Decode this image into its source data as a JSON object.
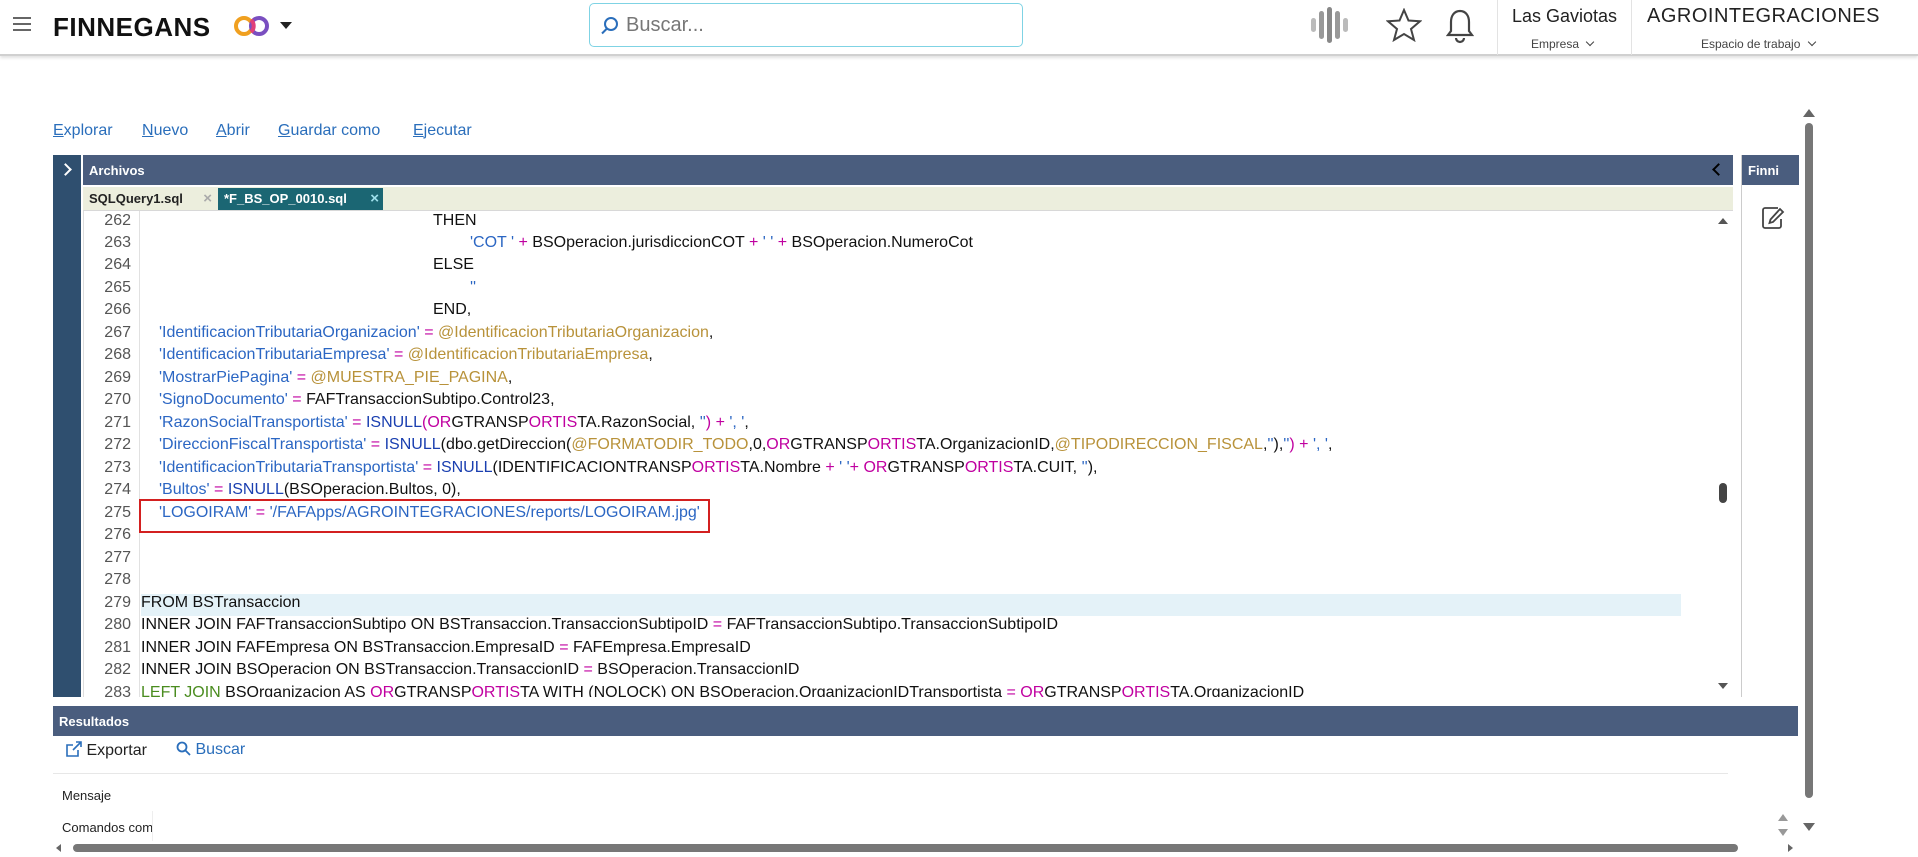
{
  "header": {
    "brand": "FINNEGANS",
    "search_placeholder": "Buscar...",
    "company_name": "Las Gaviotas",
    "company_label": "Empresa",
    "workspace_name": "AGROINTEGRACIONES",
    "workspace_label": "Espacio de trabajo",
    "icons": [
      "menu-icon",
      "brand-logo-icon",
      "chevron-down-icon",
      "search-icon",
      "voice-icon",
      "star-icon",
      "bell-icon"
    ]
  },
  "toolbar": {
    "explorar": {
      "first": "E",
      "rest": "xplorar"
    },
    "nuevo": {
      "first": "N",
      "rest": "uevo"
    },
    "abrir": {
      "first": "A",
      "rest": "brir"
    },
    "guardar": {
      "first": "G",
      "rest": "uardar como"
    },
    "ejecutar": {
      "first": "E",
      "rest": "jecutar"
    }
  },
  "editor": {
    "panel_title": "Archivos",
    "side_panel_title": "Finni",
    "tabs": [
      {
        "label": "SQLQuery1.sql",
        "active": false
      },
      {
        "label": "*F_BS_OP_0010.sql",
        "active": true
      }
    ],
    "line_numbers": [
      "262",
      "263",
      "264",
      "265",
      "266",
      "267",
      "268",
      "269",
      "270",
      "271",
      "272",
      "273",
      "274",
      "275",
      "276",
      "277",
      "278",
      "279",
      "280",
      "281",
      "282",
      "283"
    ]
  },
  "results": {
    "title": "Resultados",
    "export_label": "Exportar",
    "search_label": "Buscar",
    "items": [
      "Mensaje",
      "Comandos comp"
    ]
  },
  "colors": {
    "panel_header": "#4a5d7e",
    "active_tab": "#1b6673",
    "link": "#2a6ebb",
    "highlight_box": "#d32020",
    "keyword": "#1a3fb0",
    "string": "#2b66c3",
    "operator": "#c000a0",
    "variable": "#b8923a"
  }
}
